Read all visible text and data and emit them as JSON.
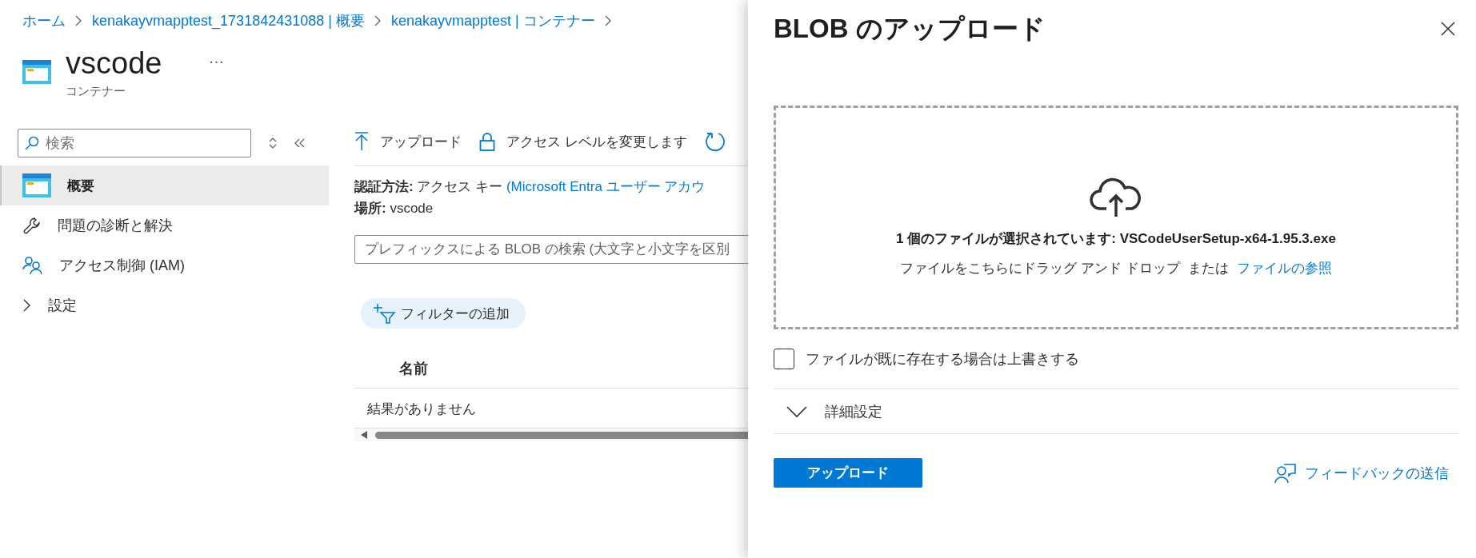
{
  "breadcrumbs": [
    {
      "label": "ホーム"
    },
    {
      "label": "kenakayvmapptest_1731842431088 | 概要"
    },
    {
      "label": "kenakayvmapptest | コンテナー"
    }
  ],
  "resource": {
    "name": "vscode",
    "type": "コンテナー",
    "more": "…"
  },
  "sidebar": {
    "search": {
      "placeholder": "検索"
    },
    "items": [
      {
        "label": "概要",
        "kind": "link",
        "selected": true
      },
      {
        "label": "問題の診断と解決",
        "kind": "link",
        "selected": false
      },
      {
        "label": "アクセス制御 (IAM)",
        "kind": "link",
        "selected": false
      },
      {
        "label": "設定",
        "kind": "group",
        "selected": false,
        "expanded": false
      }
    ]
  },
  "toolbar": {
    "buttons": [
      {
        "label": "アップロード"
      },
      {
        "label": "アクセス レベルを変更します"
      }
    ]
  },
  "details": {
    "auth_label": "認証方法:",
    "auth_value": "アクセス キー",
    "auth_link": "(Microsoft Entra ユーザー アカウ",
    "location_label": "場所:",
    "location_value": "vscode"
  },
  "blob_search": {
    "placeholder": "プレフィックスによる BLOB の検索 (大文字と小文字を区別"
  },
  "add_filter": "フィルターの追加",
  "table": {
    "columns": [
      "名前"
    ],
    "empty_message": "結果がありません"
  },
  "upload_panel": {
    "title": "BLOB のアップロード",
    "dropzone": {
      "selected_text": "1 個のファイルが選択されています: VSCodeUserSetup-x64-1.95.3.exe",
      "hint": "ファイルをこちらにドラッグ アンド ドロップ",
      "or": "または",
      "browse_link": "ファイルの参照"
    },
    "overwrite": {
      "label": "ファイルが既に存在する場合は上書きする",
      "checked": false
    },
    "advanced": {
      "label": "詳細設定",
      "expanded": false
    },
    "upload_button": "アップロード",
    "feedback_link": "フィードバックの送信"
  }
}
